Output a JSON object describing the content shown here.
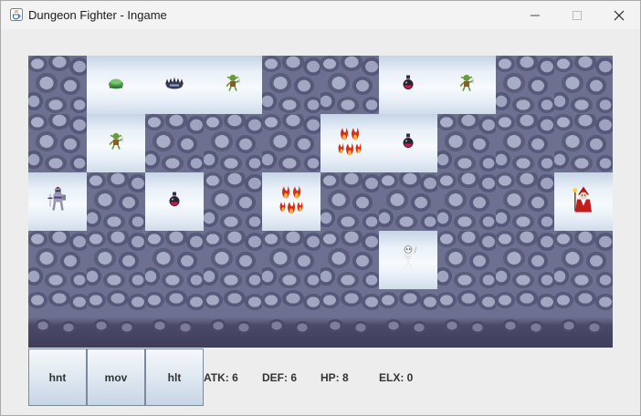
{
  "window": {
    "title": "Dungeon Fighter - Ingame",
    "icon": "java-cup-icon",
    "controls": [
      "minimize-icon",
      "maximize-icon",
      "close-icon"
    ]
  },
  "board": {
    "columns": 10,
    "rows": 5,
    "tiles": [
      [
        "wall",
        "floor",
        "floor",
        "floor",
        "wall",
        "wall",
        "floor",
        "floor",
        "wall",
        "wall"
      ],
      [
        "wall",
        "floor",
        "wall",
        "wall",
        "wall",
        "floor",
        "floor",
        "wall",
        "wall",
        "wall"
      ],
      [
        "floor",
        "wall",
        "floor",
        "wall",
        "floor",
        "wall",
        "wall",
        "wall",
        "wall",
        "floor"
      ],
      [
        "wall",
        "wall",
        "wall",
        "wall",
        "wall",
        "wall",
        "floor",
        "wall",
        "wall",
        "wall"
      ],
      [
        "bottom",
        "bottom",
        "bottom",
        "bottom",
        "bottom",
        "bottom",
        "bottom",
        "bottom",
        "bottom",
        "bottom"
      ]
    ],
    "entities": [
      [
        "",
        "slime",
        "spiked-shell",
        "goblin",
        "",
        "",
        "potion",
        "goblin",
        "",
        ""
      ],
      [
        "",
        "goblin",
        "",
        "",
        "",
        "fire",
        "potion",
        "",
        "",
        ""
      ],
      [
        "knight",
        "",
        "potion",
        "",
        "fire",
        "",
        "",
        "",
        "",
        "red-wizard"
      ],
      [
        "",
        "",
        "",
        "",
        "",
        "",
        "skeleton",
        "",
        "",
        ""
      ],
      [
        "",
        "",
        "",
        "",
        "",
        "",
        "",
        "",
        "",
        ""
      ]
    ]
  },
  "buttons": {
    "hnt": "hnt",
    "mov": "mov",
    "hlt": "hlt"
  },
  "stats": {
    "atk": "ATK: 6",
    "def": "DEF: 6",
    "hp": "HP: 8",
    "elx": "ELX: 0"
  }
}
